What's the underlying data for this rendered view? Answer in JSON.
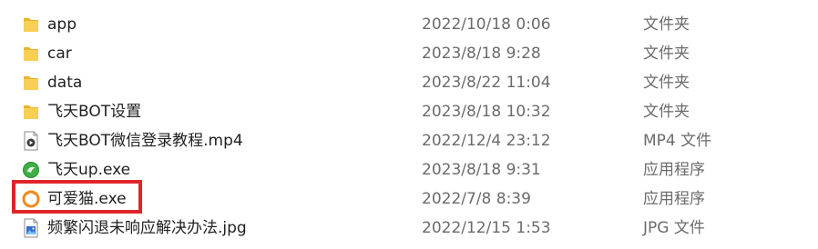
{
  "files": [
    {
      "name": "app",
      "modified": "2022/10/18 0:06",
      "type": "文件夹",
      "icon": "folder-icon"
    },
    {
      "name": "car",
      "modified": "2023/8/18 9:28",
      "type": "文件夹",
      "icon": "folder-icon"
    },
    {
      "name": "data",
      "modified": "2023/8/22 11:04",
      "type": "文件夹",
      "icon": "folder-icon"
    },
    {
      "name": "飞天BOT设置",
      "modified": "2023/8/18 10:32",
      "type": "文件夹",
      "icon": "folder-icon"
    },
    {
      "name": "飞天BOT微信登录教程.mp4",
      "modified": "2022/12/4 23:12",
      "type": "MP4 文件",
      "icon": "video-file-icon"
    },
    {
      "name": "飞天up.exe",
      "modified": "2023/8/18 9:31",
      "type": "应用程序",
      "icon": "green-app-icon"
    },
    {
      "name": "可爱猫.exe",
      "modified": "2022/7/8 8:39",
      "type": "应用程序",
      "icon": "cat-app-icon"
    },
    {
      "name": "频繁闪退未响应解决办法.jpg",
      "modified": "2022/12/15 1:53",
      "type": "JPG 文件",
      "icon": "image-file-icon"
    }
  ],
  "colors": {
    "folder": "#f5c542",
    "highlight": "#e0242a",
    "secondary_text": "#6b6b6b"
  }
}
